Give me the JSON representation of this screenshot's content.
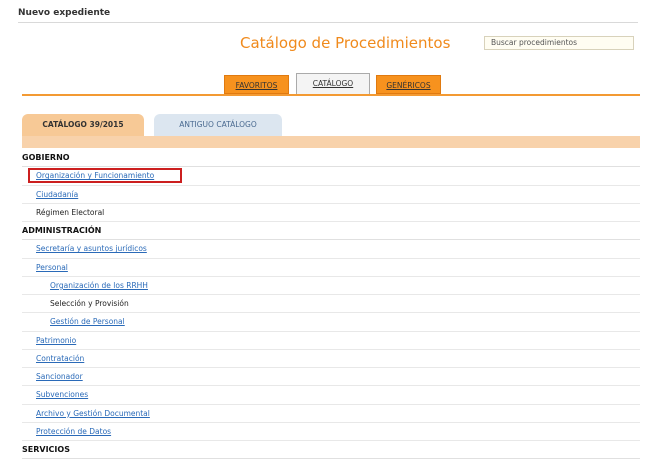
{
  "header": {
    "new_record": "Nuevo expediente",
    "title": "Catálogo de Procedimientos",
    "search_placeholder": "Buscar procedimientos"
  },
  "top_tabs": [
    {
      "label": "FAVORITOS",
      "active": false
    },
    {
      "label": "CATÁLOGO",
      "active": true
    },
    {
      "label": "GENÉRICOS",
      "active": false
    }
  ],
  "sub_tabs": [
    {
      "label": "CATÁLOGO 39/2015",
      "active": true
    },
    {
      "label": "ANTIGUO CATÁLOGO",
      "active": false
    }
  ],
  "colors": {
    "accent": "#f7921e",
    "title": "#f08a1c",
    "link": "#2a6ab8",
    "highlight": "#cc1f1f"
  },
  "list": [
    {
      "label": "GOBIERNO",
      "type": "section"
    },
    {
      "label": "Organización y Funcionamiento",
      "type": "link",
      "level": 1,
      "highlighted": true
    },
    {
      "label": "Ciudadanía",
      "type": "link",
      "level": 1
    },
    {
      "label": "Régimen Electoral",
      "type": "plain",
      "level": 1
    },
    {
      "label": "ADMINISTRACIÓN",
      "type": "section"
    },
    {
      "label": "Secretaría y asuntos jurídicos",
      "type": "link",
      "level": 1
    },
    {
      "label": "Personal",
      "type": "link",
      "level": 1
    },
    {
      "label": "Organización de los RRHH",
      "type": "link",
      "level": 2
    },
    {
      "label": "Selección y Provisión",
      "type": "plain",
      "level": 2
    },
    {
      "label": "Gestión de Personal",
      "type": "link",
      "level": 2
    },
    {
      "label": "Patrimonio",
      "type": "link",
      "level": 1
    },
    {
      "label": "Contratación",
      "type": "link",
      "level": 1
    },
    {
      "label": "Sancionador",
      "type": "link",
      "level": 1
    },
    {
      "label": "Subvenciones",
      "type": "link",
      "level": 1
    },
    {
      "label": "Archivo y Gestión Documental",
      "type": "link",
      "level": 1
    },
    {
      "label": "Protección de Datos",
      "type": "link",
      "level": 1
    },
    {
      "label": "SERVICIOS",
      "type": "section"
    }
  ]
}
